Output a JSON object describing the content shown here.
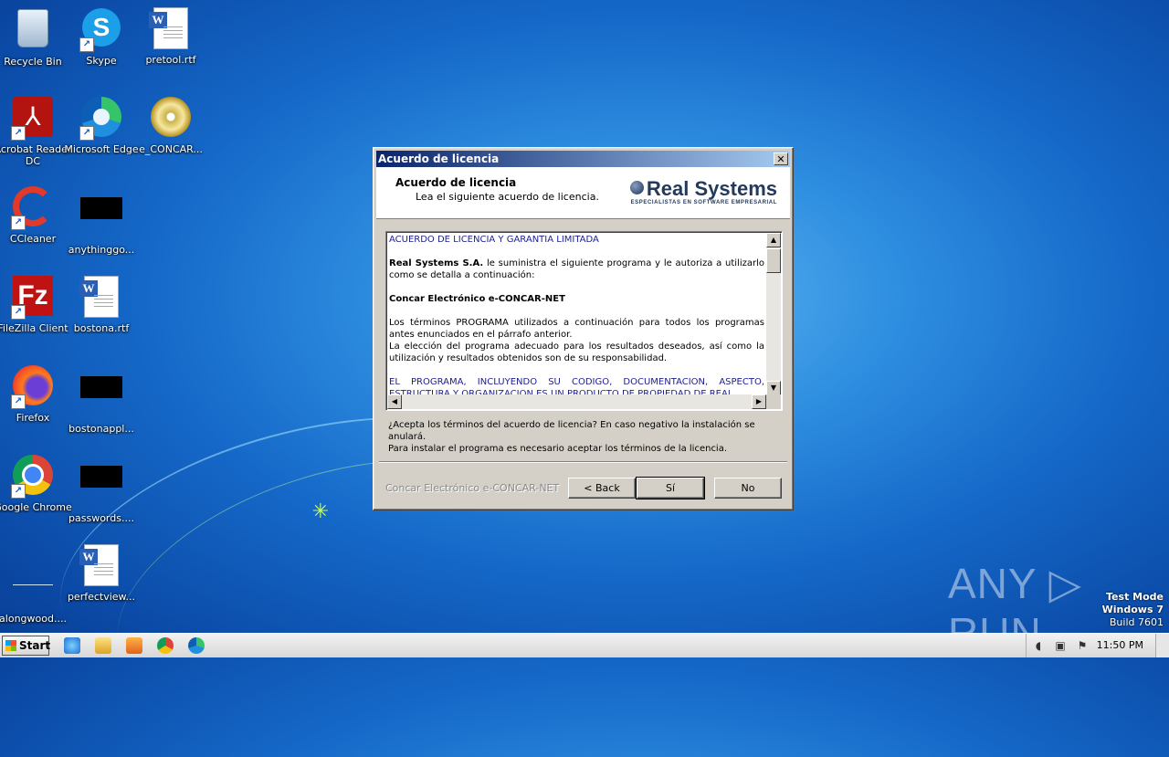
{
  "desktop": {
    "icons": [
      {
        "label": "Recycle Bin",
        "icon": "recycle-bin-icon"
      },
      {
        "label": "Skype",
        "icon": "skype-icon"
      },
      {
        "label": "pretool.rtf",
        "icon": "word-document-icon"
      },
      {
        "label": "Acrobat Reader DC",
        "icon": "acrobat-icon"
      },
      {
        "label": "Microsoft Edge",
        "icon": "edge-icon"
      },
      {
        "label": "e_CONCAR...",
        "icon": "setup-disc-icon"
      },
      {
        "label": "CCleaner",
        "icon": "ccleaner-icon"
      },
      {
        "label": "anythinggo...",
        "icon": "black-thumbnail-icon"
      },
      {
        "label": "FileZilla Client",
        "icon": "filezilla-icon"
      },
      {
        "label": "bostona.rtf",
        "icon": "word-document-icon"
      },
      {
        "label": "Firefox",
        "icon": "firefox-icon"
      },
      {
        "label": "bostonappl...",
        "icon": "black-thumbnail-icon"
      },
      {
        "label": "Google Chrome",
        "icon": "chrome-icon"
      },
      {
        "label": "passwords....",
        "icon": "black-thumbnail-icon"
      },
      {
        "label": "alongwood....",
        "icon": "blank-file-icon"
      },
      {
        "label": "perfectview...",
        "icon": "word-document-icon"
      }
    ]
  },
  "dialog": {
    "title": "Acuerdo de licencia",
    "close_glyph": "✕",
    "header_title": "Acuerdo de licencia",
    "header_subtitle": "Lea el siguiente acuerdo de licencia.",
    "logo_name": "Real Systems",
    "logo_tagline": "ESPECIALISTAS EN SOFTWARE EMPRESARIAL",
    "license": {
      "heading": "ACUERDO DE LICENCIA Y GARANTIA LIMITADA",
      "para1_bold": "Real Systems S.A.",
      "para1_rest": " le suministra el  siguiente  programa y le autoriza a utilizarlo como se detalla a continuación:",
      "product": "Concar Electrónico e-CONCAR-NET",
      "para2": "Los términos PROGRAMA utilizados a continuación para todos los programas antes enunciados en el párrafo anterior.",
      "para3": "La elección del programa adecuado para los resultados deseados, así como la utilización y resultados obtenidos son de su responsabilidad.",
      "para4": "EL PROGRAMA, INCLUYENDO SU CODIGO, DOCUMENTACION, ASPECTO, ESTRUCTURA Y ORGANIZACION ES UN PRODUCTO DE PROPIEDAD DE REAL"
    },
    "question_line1": "¿Acepta los términos del acuerdo de licencia?  En caso negativo la instalación se anulará.",
    "question_line2": "Para instalar el programa es necesario aceptar los términos de la licencia.",
    "footer_label": "Concar Electrónico e-CONCAR-NET",
    "buttons": {
      "back": "< Back",
      "yes": "Sí",
      "no": "No"
    }
  },
  "watermark": {
    "brand": "ANY ▷ RUN",
    "line1": "Test Mode",
    "line2": "Windows 7",
    "line3": "Build 7601"
  },
  "taskbar": {
    "start_label": "Start",
    "clock": "11:50 PM",
    "pinned": [
      "internet-explorer-icon",
      "file-explorer-icon",
      "media-player-icon",
      "chrome-icon",
      "edge-icon"
    ]
  }
}
